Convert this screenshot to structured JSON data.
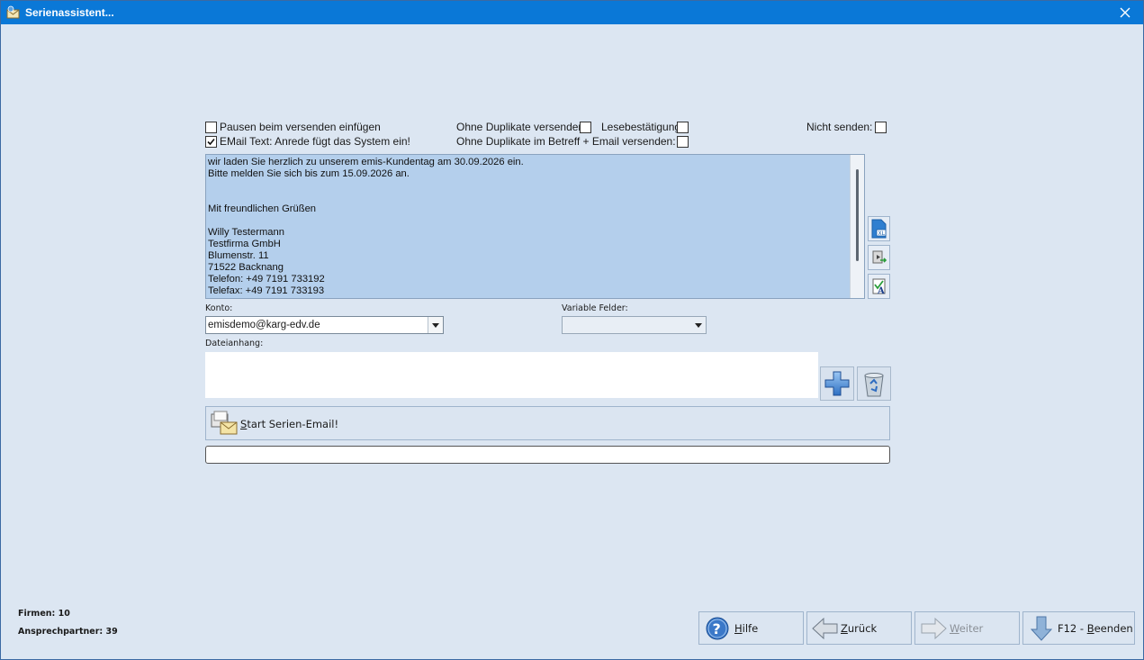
{
  "window": {
    "title": "Serienassistent..."
  },
  "options": {
    "pausen_label": "Pausen beim versenden einfügen",
    "pausen_checked": false,
    "email_text_label": "EMail Text: Anrede fügt das System ein!",
    "email_text_checked": true,
    "ohne_duplikate_label": "Ohne Duplikate versenden:",
    "ohne_duplikate_checked": false,
    "lesebestaetigung_label": "Lesebestätigung:",
    "lesebestaetigung_checked": false,
    "nicht_senden_label": "Nicht senden:",
    "nicht_senden_checked": false,
    "ohne_duplikate_betreff_label": "Ohne Duplikate im Betreff + Email versenden:",
    "ohne_duplikate_betreff_checked": false
  },
  "message_body": "wir laden Sie herzlich zu unserem emis-Kundentag am 30.09.2026 ein.\nBitte melden Sie sich bis zum 15.09.2026 an.\n\n\nMit freundlichen Grüßen\n\nWilly Testermann\nTestfirma GmbH\nBlumenstr. 11\n71522 Backnang\nTelefon: +49 7191 733192\nTelefax: +49 7191 733193",
  "konto": {
    "label": "Konto:",
    "value": "emisdemo@karg-edv.de"
  },
  "variable_felder": {
    "label": "Variable Felder:",
    "value": ""
  },
  "dateianhang": {
    "label": "Dateianhang:"
  },
  "start_button": {
    "label_hotkey": "S",
    "label_rest": "tart Serien-Email!"
  },
  "progress": {
    "value": 0
  },
  "status": {
    "firmen": "Firmen: 10",
    "ansprechpartner": "Ansprechpartner: 39"
  },
  "nav": {
    "hilfe_hotkey": "H",
    "hilfe_rest": "ilfe",
    "zurueck_hotkey": "Z",
    "zurueck_rest": "urück",
    "weiter_hotkey": "W",
    "weiter_rest": "eiter",
    "beenden_prefix": "F12 - ",
    "beenden_hotkey": "B",
    "beenden_rest": "eenden"
  },
  "colors": {
    "titlebar": "#0a78d7",
    "window_bg": "#dce6f2",
    "memo_bg": "#b4cfec"
  },
  "icons": [
    "app-icon",
    "close-icon",
    "excel-icon",
    "insert-field-icon",
    "spellcheck-icon",
    "add-attachment-icon",
    "recycle-bin-icon",
    "email-send-icon",
    "help-icon",
    "back-arrow-icon",
    "forward-arrow-icon",
    "exit-arrow-icon"
  ]
}
